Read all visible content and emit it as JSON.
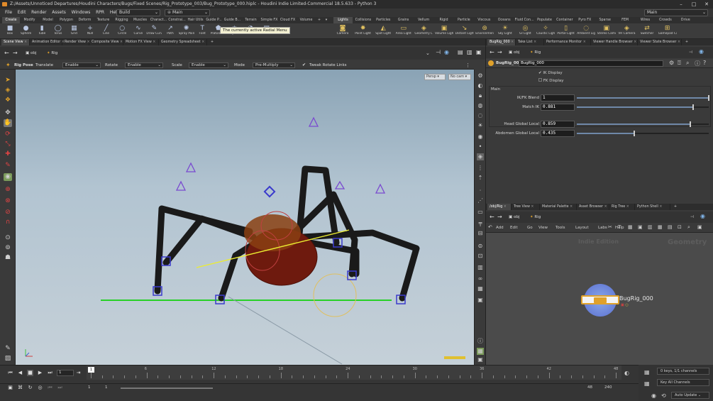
{
  "window": {
    "title": "Z:/Assets/Unnoticed Departures/Houdini Characters/Bugs/Fixed Scenes/Rig_Prototype_003/Bug_Prototype_000.hiplc - Houdini Indie Limited-Commercial 18.5.633 - Python 3"
  },
  "menubar": {
    "items": [
      "File",
      "Edit",
      "Render",
      "Assets",
      "Windows",
      "RPR",
      "Help"
    ],
    "desktop_left": "Build",
    "desktop_center": "Main",
    "desktop_right": "Main"
  },
  "shelf": {
    "tabs_left": [
      "Create",
      "Modify",
      "Model",
      "Polygon",
      "Deform",
      "Texture",
      "Rigging",
      "Muscles",
      "Charact...",
      "Constrai...",
      "Hair Utils",
      "Guide P...",
      "Guide B...",
      "Terrain",
      "Simple FX",
      "Cloud FX",
      "Volume"
    ],
    "tabs_right": [
      "Lights and...",
      "Collisions",
      "Particles",
      "Grains",
      "Vellum",
      "Rigid Bodies",
      "Particle Fl...",
      "Viscous Fl...",
      "Oceans",
      "Fluid Con...",
      "Populate C...",
      "Container ...",
      "Pyro FX",
      "Sparse Pyr...",
      "FEM",
      "Wires",
      "Crowds",
      "Drive Sim..."
    ],
    "tools_left": [
      "Box",
      "Sphere",
      "Tube",
      "Torus",
      "Grid",
      "Null",
      "Line",
      "Circle",
      "Curve",
      "Draw Curve",
      "Path",
      "Spray Paint",
      "Font",
      "Platonic Solids",
      "L-System",
      "Metaball",
      "File"
    ],
    "tools_right": [
      "Camera",
      "Point Light",
      "Spot Light",
      "Area Light",
      "Geometry Light",
      "Volume Light",
      "Distant Light",
      "Environment Light",
      "Sky Light",
      "GI Light",
      "Caustic Light",
      "Portal Light",
      "Ambient Light",
      "Stereo Camera",
      "VR Camera",
      "Switcher",
      "Gamepad Camera"
    ],
    "tooltip": "The currently active Radial Menu"
  },
  "viewer_tabs": [
    "Scene View",
    "Animation Editor",
    "Render View",
    "Composite View",
    "Motion FX View",
    "Geometry Spreadsheet"
  ],
  "viewer_path": {
    "root": "obj",
    "node": "Rig"
  },
  "operation_bar": {
    "state": "Rig Pose",
    "translate_label": "Translate",
    "translate_value": "Enable",
    "rotate_label": "Rotate",
    "rotate_value": "Enable",
    "scale_label": "Scale",
    "scale_value": "Enable",
    "mode_label": "Mode",
    "mode_value": "Pre-Multiply",
    "tweak_label": "Tweak Rotate Links",
    "tweak_checked": true
  },
  "viewport": {
    "camera_label": "Persp",
    "camera2_label": "No cam"
  },
  "param_tabs": [
    "BugRig_000",
    "Take List",
    "Performance Monitor",
    "Viewer Handle Browser",
    "Viewer State Browser"
  ],
  "param_path": {
    "root": "obj",
    "node": "Rig"
  },
  "params": {
    "node_type": "BugRig_000",
    "node_name": "BugRig_000",
    "ik_display": "IK Display",
    "ik_display_checked": true,
    "fk_display": "FK Display",
    "fk_display_checked": false,
    "section": "Main",
    "rows": [
      {
        "label": "IK/FK Blend",
        "value": "1",
        "fraction": 1.0
      },
      {
        "label": "Match IK",
        "value": "0.881",
        "fraction": 0.881
      },
      {
        "label": "Head Global Local",
        "value": "0.859",
        "fraction": 0.859
      },
      {
        "label": "Abdomen Global Local",
        "value": "0.435",
        "fraction": 0.435
      }
    ]
  },
  "network_tabs": [
    "/obj/Rig",
    "Tree View",
    "Material Palette",
    "Asset Browser",
    "Rig Tree",
    "Python Shell"
  ],
  "network_path": {
    "root": "obj",
    "node": "Rig"
  },
  "network_menu": [
    "Add",
    "Edit",
    "Go",
    "View",
    "Tools",
    "Layout",
    "Labs",
    "Help"
  ],
  "network": {
    "watermark_edition": "Indie Edition",
    "watermark_context": "Geometry",
    "node_name": "BugRig_000"
  },
  "timeline": {
    "current_frame": "1",
    "ticks": [
      "1",
      "6",
      "12",
      "18",
      "24",
      "30",
      "36",
      "42",
      "48"
    ],
    "start": "1",
    "start2": "1",
    "end": "48",
    "end2": "240",
    "keys_label": "0 keys, 1/1 channels",
    "key_all": "Key All Channels",
    "auto_update": "Auto Update"
  },
  "colors": {
    "accent": "#e0a12a",
    "handle": "#3a3acc",
    "bug_body": "#6e1a0e"
  }
}
